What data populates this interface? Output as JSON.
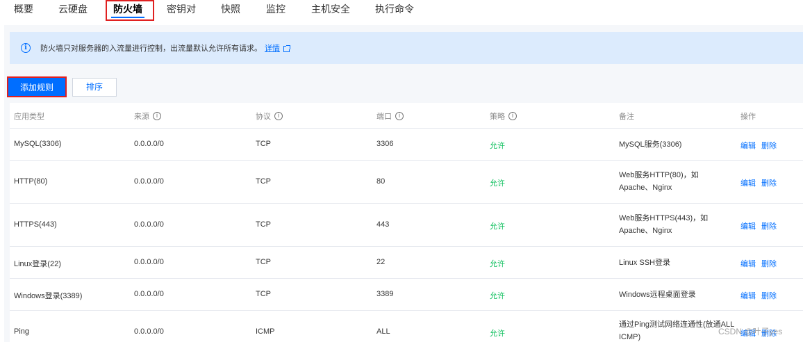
{
  "tabs": [
    {
      "label": "概要"
    },
    {
      "label": "云硬盘"
    },
    {
      "label": "防火墙"
    },
    {
      "label": "密钥对"
    },
    {
      "label": "快照"
    },
    {
      "label": "监控"
    },
    {
      "label": "主机安全"
    },
    {
      "label": "执行命令"
    }
  ],
  "active_tab": "防火墙",
  "info": {
    "text": "防火墙只对服务器的入流量进行控制，出流量默认允许所有请求。",
    "link": "详情",
    "icon": "info-icon"
  },
  "buttons": {
    "add_rule": "添加规则",
    "sort": "排序"
  },
  "table": {
    "headers": [
      "应用类型",
      "来源",
      "协议",
      "端口",
      "策略",
      "备注",
      "操作"
    ],
    "rows": [
      {
        "app": "MySQL(3306)",
        "source": "0.0.0.0/0",
        "protocol": "TCP",
        "port": "3306",
        "policy": "允许",
        "remark": "MySQL服务(3306)",
        "edit": "编辑",
        "delete": "删除"
      },
      {
        "app": "HTTP(80)",
        "source": "0.0.0.0/0",
        "protocol": "TCP",
        "port": "80",
        "policy": "允许",
        "remark": "Web服务HTTP(80)，如Apache、Nginx",
        "edit": "编辑",
        "delete": "删除"
      },
      {
        "app": "HTTPS(443)",
        "source": "0.0.0.0/0",
        "protocol": "TCP",
        "port": "443",
        "policy": "允许",
        "remark": "Web服务HTTPS(443)，如Apache、Nginx",
        "edit": "编辑",
        "delete": "删除"
      },
      {
        "app": "Linux登录(22)",
        "source": "0.0.0.0/0",
        "protocol": "TCP",
        "port": "22",
        "policy": "允许",
        "remark": "Linux SSH登录",
        "edit": "编辑",
        "delete": "删除"
      },
      {
        "app": "Windows登录(3389)",
        "source": "0.0.0.0/0",
        "protocol": "TCP",
        "port": "3389",
        "policy": "允许",
        "remark": "Windows远程桌面登录",
        "edit": "编辑",
        "delete": "删除"
      },
      {
        "app": "Ping",
        "source": "0.0.0.0/0",
        "protocol": "ICMP",
        "port": "ALL",
        "policy": "允许",
        "remark": "通过Ping测试网络连通性(放通ALL ICMP)",
        "edit": "编辑",
        "delete": "删除"
      }
    ]
  },
  "watermark": "CSDN @叶子yes",
  "colors": {
    "accent": "#006eff",
    "allow": "#0abf5b",
    "highlight": "#e02020",
    "info_bg": "#dcebfd"
  }
}
